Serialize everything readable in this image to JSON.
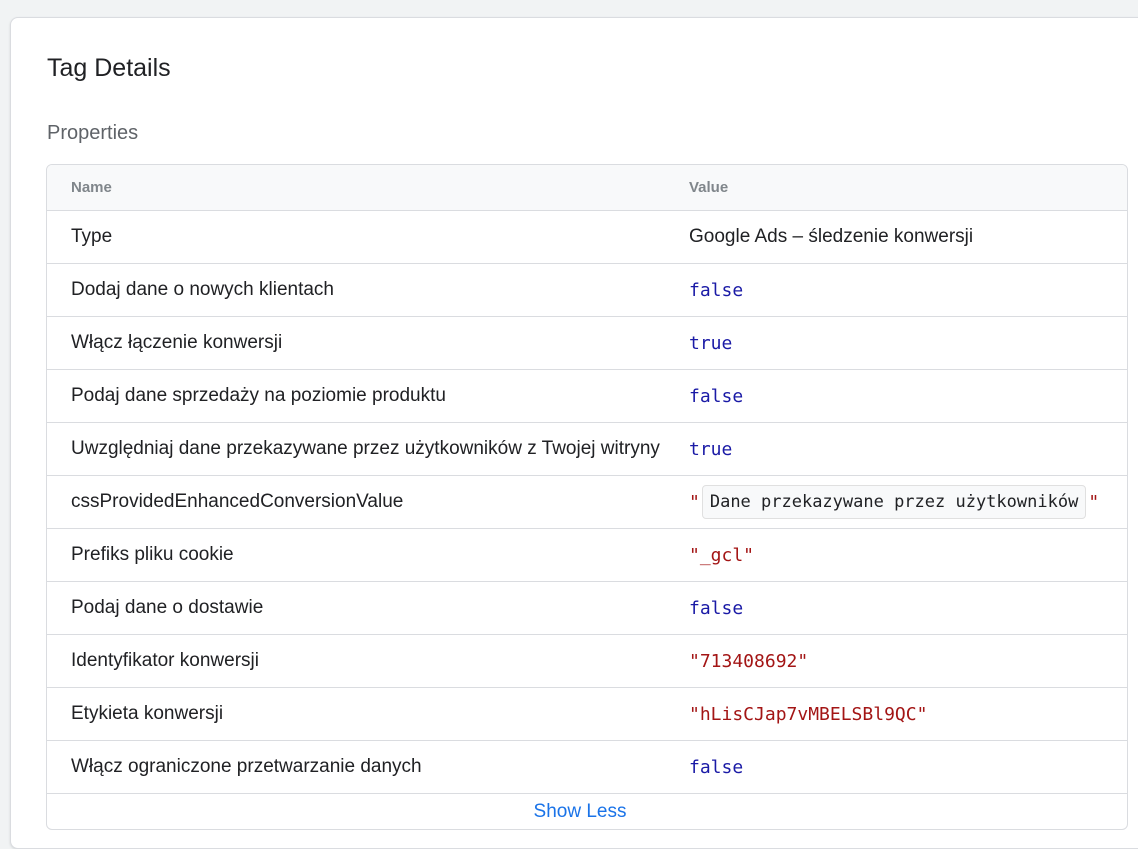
{
  "panel": {
    "title": "Tag Details",
    "section_title": "Properties"
  },
  "table": {
    "headers": {
      "name": "Name",
      "value": "Value"
    },
    "rows": [
      {
        "name": "Type",
        "value": "Google Ads – śledzenie konwersji",
        "kind": "text"
      },
      {
        "name": "Dodaj dane o nowych klientach",
        "value": "false",
        "kind": "bool"
      },
      {
        "name": "Włącz łączenie konwersji",
        "value": "true",
        "kind": "bool"
      },
      {
        "name": "Podaj dane sprzedaży na poziomie produktu",
        "value": "false",
        "kind": "bool"
      },
      {
        "name": "Uwzględniaj dane przekazywane przez użytkowników z Twojej witryny",
        "value": "true",
        "kind": "bool"
      },
      {
        "name": "cssProvidedEnhancedConversionValue",
        "value_open_quote": "\"",
        "value": "Dane przekazywane przez użytkowników",
        "value_close_quote": "\"",
        "kind": "chip"
      },
      {
        "name": "Prefiks pliku cookie",
        "value": "\"_gcl\"",
        "kind": "str"
      },
      {
        "name": "Podaj dane o dostawie",
        "value": "false",
        "kind": "bool"
      },
      {
        "name": "Identyfikator konwersji",
        "value": "\"713408692\"",
        "kind": "str"
      },
      {
        "name": "Etykieta konwersji",
        "value": "\"hLisCJap7vMBELSBl9QC\"",
        "kind": "str"
      },
      {
        "name": "Włącz ograniczone przetwarzanie danych",
        "value": "false",
        "kind": "bool"
      }
    ],
    "footer_link": "Show Less"
  },
  "colors": {
    "bool": "#1a1aa6",
    "string": "#a31515",
    "link": "#1a73e8"
  }
}
